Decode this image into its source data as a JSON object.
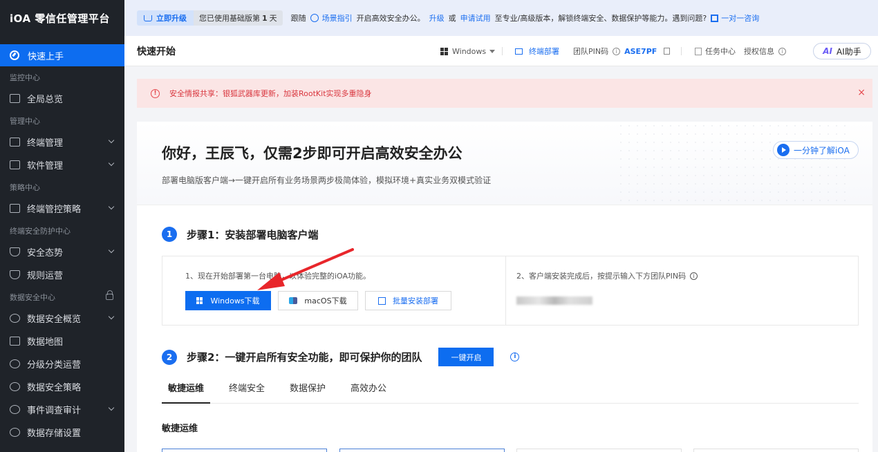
{
  "sidebar": {
    "brand": "iOA 零信任管理平台",
    "active_item": "快速上手",
    "sections": {
      "monitor": "监控中心",
      "manage": "管理中心",
      "policy": "策略中心",
      "endpoint_security": "终端安全防护中心",
      "data_security": "数据安全中心"
    },
    "items": {
      "overview": "全局总览",
      "terminal_mgmt": "终端管理",
      "software_mgmt": "软件管理",
      "terminal_policy": "终端管控策略",
      "security_posture": "安全态势",
      "rule_ops": "规则运营",
      "data_overview": "数据安全概览",
      "data_map": "数据地图",
      "classification": "分级分类运营",
      "data_policy": "数据安全策略",
      "event_audit": "事件调查审计",
      "data_storage": "数据存储设置"
    }
  },
  "banner": {
    "upgrade": "立即升级",
    "trial_prefix": "您已使用基础版第",
    "trial_day": "1",
    "trial_suffix": "天",
    "follow": "跟随",
    "scene_guide": "场景指引",
    "start_office": "开启高效安全办公。",
    "upgrade_link": "升级",
    "or": "或",
    "apply_trial": "申请试用",
    "to_pro": "至专业/高级版本，解锁终端安全、数据保护等能力。遇到问题?",
    "consult": "一对一咨询"
  },
  "header": {
    "title": "快速开始",
    "os": "Windows",
    "deploy": "终端部署",
    "team_pin_label": "团队PIN码",
    "team_pin": "ASE7PF",
    "task_center": "任务中心",
    "license_info": "授权信息",
    "ai_assistant": "AI助手",
    "ai_icon_text": "AI"
  },
  "alert": {
    "text": "安全情报共享：银狐武器库更新，加装RootKit实现多重隐身",
    "close": "×"
  },
  "hero": {
    "greeting": "你好，王辰飞，仅需2步即可开启高效安全办公",
    "subtitle": "部署电脑版客户端→一键开启所有业务场景两步极简体验，模拟环境+真实业务双模式验证",
    "video": "一分钟了解iOA"
  },
  "step1": {
    "num": "1",
    "title": "步骤1：安装部署电脑客户端",
    "left_text": "1、现在开始部署第一台电脑，以体验完整的iOA功能。",
    "right_text": "2、客户端安装完成后，按提示输入下方团队PIN码",
    "win_download": "Windows下载",
    "mac_download": "macOS下载",
    "batch_deploy": "批量安装部署"
  },
  "step2": {
    "num": "2",
    "title": "步骤2：一键开启所有安全功能，即可保护你的团队",
    "enable": "一键开启"
  },
  "tabs": [
    "敏捷运维",
    "终端安全",
    "数据保护",
    "高效办公"
  ],
  "section_title": "敏捷运维",
  "colors": {
    "primary": "#0d6df0",
    "sidebar_bg": "#1f2329",
    "alert_bg": "#fbe5e5",
    "alert_text": "#d9363e"
  },
  "icons": {
    "arrow": "red-arrow-annotation"
  }
}
